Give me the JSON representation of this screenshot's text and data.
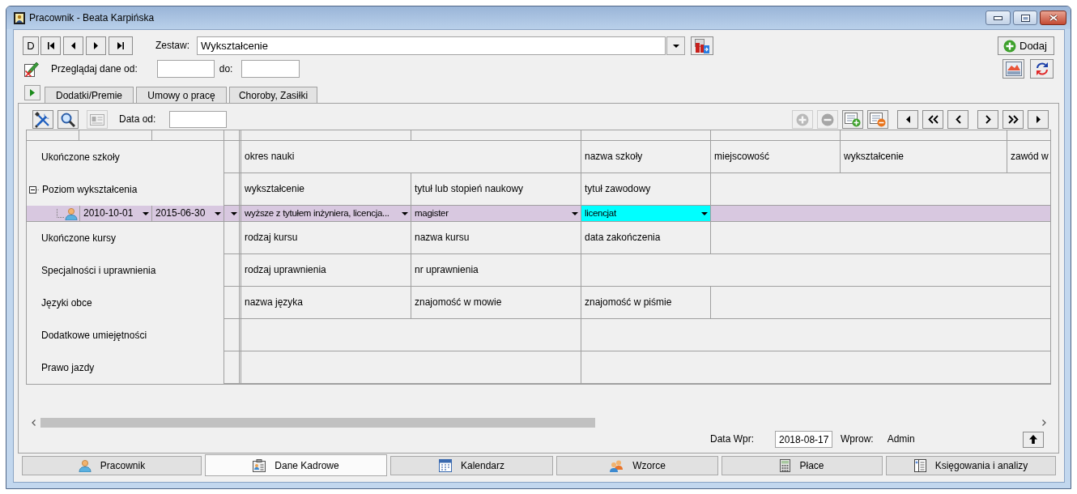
{
  "window": {
    "title": "Pracownik - Beata Karpińska"
  },
  "record_bar": {
    "first_button": "D",
    "set_label": "Zestaw:",
    "set_value": "Wykształcenie",
    "add_button": "Dodaj"
  },
  "filter": {
    "label": "Przeglądaj dane od:",
    "to_label": "do:"
  },
  "tabs": [
    {
      "label": "Dodatki/Premie",
      "selected": false
    },
    {
      "label": "Umowy o pracę",
      "selected": false
    },
    {
      "label": "Choroby, Zasiłki",
      "selected": false
    }
  ],
  "toolbar": {
    "tool_buttons": [
      {
        "disabled": false
      },
      {
        "disabled": false
      },
      {
        "disabled": true
      }
    ],
    "date_label": "Data od:",
    "row_buttons": [
      {
        "disabled": true
      },
      {
        "disabled": true
      },
      {
        "disabled": false
      },
      {
        "disabled": false
      }
    ]
  },
  "grid": {
    "sections": [
      {
        "label": "Ukończone szkoły",
        "cells": [
          {
            "kind": "group",
            "text": "okres nauki"
          },
          {
            "kind": "field",
            "text": "nazwa szkoły"
          },
          {
            "kind": "field",
            "text": "miejscowość"
          },
          {
            "kind": "field",
            "text": "wykształcenie"
          },
          {
            "kind": "field",
            "text": "zawód w"
          }
        ]
      },
      {
        "label": "Poziom wykształcenia",
        "expanded": true,
        "cells": [
          {
            "kind": "field",
            "text": "wykształcenie"
          },
          {
            "kind": "field",
            "text": "tytuł lub stopień naukowy"
          },
          {
            "kind": "field",
            "text": "tytuł zawodowy"
          }
        ],
        "children": [
          {
            "selected": true,
            "date_from": "2010-10-01",
            "date_to": "2015-06-30",
            "values": [
              {
                "text": "wyższe z tytułem inżyniera, licencja...",
                "focused": false
              },
              {
                "text": "magister",
                "focused": false
              },
              {
                "text": "licencjat",
                "focused": true
              }
            ]
          }
        ]
      },
      {
        "label": "Ukończone kursy",
        "cells": [
          {
            "kind": "field",
            "text": "rodzaj kursu"
          },
          {
            "kind": "field",
            "text": "nazwa kursu"
          },
          {
            "kind": "field",
            "text": "data zakończenia"
          }
        ]
      },
      {
        "label": "Specjalności i uprawnienia",
        "cells": [
          {
            "kind": "field",
            "text": "rodzaj uprawnienia"
          },
          {
            "kind": "field",
            "text": "nr uprawnienia"
          }
        ]
      },
      {
        "label": "Języki obce",
        "cells": [
          {
            "kind": "field",
            "text": "nazwa języka"
          },
          {
            "kind": "field",
            "text": "znajomość w mowie"
          },
          {
            "kind": "field",
            "text": "znajomość w piśmie"
          }
        ]
      },
      {
        "label": "Dodatkowe umiejętności"
      },
      {
        "label": "Prawo jazdy"
      }
    ]
  },
  "footer": {
    "date_label": "Data Wpr:",
    "date_value": "2018-08-17",
    "user_label": "Wprow:",
    "user_value": "Admin"
  },
  "bottom_tabs": [
    {
      "label": "Pracownik",
      "selected": false
    },
    {
      "label": "Dane Kadrowe",
      "selected": true
    },
    {
      "label": "Kalendarz",
      "selected": false
    },
    {
      "label": "Wzorce",
      "selected": false
    },
    {
      "label": "Płace",
      "selected": false
    },
    {
      "label": "Księgowania i analizy",
      "selected": false
    }
  ]
}
